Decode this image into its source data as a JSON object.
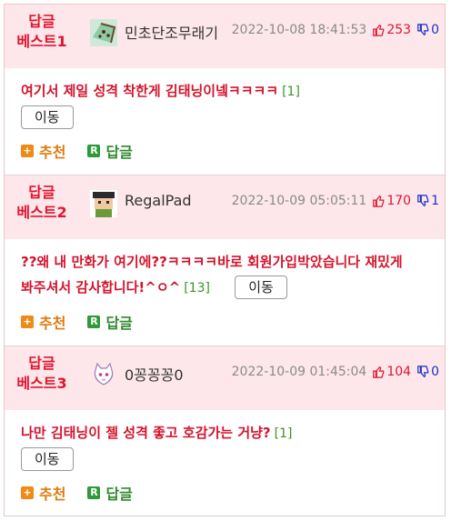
{
  "comments": [
    {
      "rank": [
        "답글",
        "베스트1"
      ],
      "username": "민초단조무래기",
      "timestamp": "2022-10-08 18:41:53",
      "upvotes": "253",
      "downvotes": "0",
      "text": "여기서 제일 성격 착한게 김태닝이넼ㅋㅋㅋㅋ",
      "reply_count": "[1]",
      "move_label": "이동",
      "recommend_label": "추천",
      "reply_label": "답글",
      "avatar_icon": "mint-chocolate-icon"
    },
    {
      "rank": [
        "답글",
        "베스트2"
      ],
      "username": "RegalPad",
      "timestamp": "2022-10-09 05:05:11",
      "upvotes": "170",
      "downvotes": "1",
      "text": "??왜 내 만화가 여기에??ㅋㅋㅋㅋ바로 회원가입박았습니다 재밌게 봐주셔서 감사합니다!^ㅇ^",
      "reply_count": "[13]",
      "move_label": "이동",
      "recommend_label": "추천",
      "reply_label": "답글",
      "avatar_icon": "pixel-character-icon"
    },
    {
      "rank": [
        "답글",
        "베스트3"
      ],
      "username": "0꽁꽁꽁0",
      "timestamp": "2022-10-09 01:45:04",
      "upvotes": "104",
      "downvotes": "0",
      "text": "나만 김태닝이 젤 성격 좋고 호감가는 거냥?",
      "reply_count": "[1]",
      "move_label": "이동",
      "recommend_label": "추천",
      "reply_label": "답글",
      "avatar_icon": "cat-icon"
    }
  ],
  "colors": {
    "rank": "#e0152f",
    "header_bg": "#fde7ea",
    "upvote": "#e0152f",
    "downvote": "#1a32c4",
    "reply_count": "#3f9228",
    "recommend": "#e07a10",
    "reply": "#2e8a2e"
  }
}
